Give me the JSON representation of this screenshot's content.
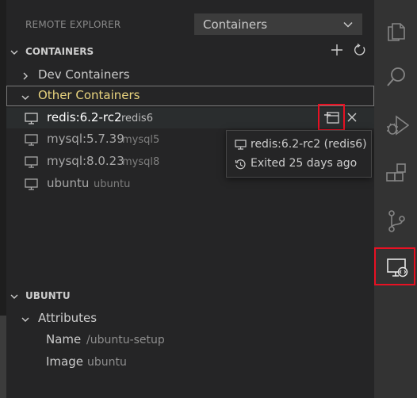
{
  "header": {
    "title": "REMOTE EXPLORER",
    "select_value": "Containers"
  },
  "containers_section": {
    "title": "CONTAINERS",
    "groups": [
      {
        "label": "Dev Containers",
        "expanded": false
      },
      {
        "label": "Other Containers",
        "expanded": true
      }
    ],
    "items": [
      {
        "name": "redis:6.2-rc2",
        "alias": "redis6"
      },
      {
        "name": "mysql:5.7.39",
        "alias": "mysql5"
      },
      {
        "name": "mysql:8.0.23",
        "alias": "mysql8"
      },
      {
        "name": "ubuntu",
        "alias": "ubuntu"
      }
    ]
  },
  "tooltip": {
    "line1": "redis:6.2-rc2 (redis6)",
    "line2": "Exited 25 days ago"
  },
  "details_section": {
    "title": "UBUNTU",
    "group": "Attributes",
    "attributes": [
      {
        "key": "Name",
        "value": "/ubuntu-setup"
      },
      {
        "key": "Image",
        "value": "ubuntu"
      }
    ]
  },
  "colors": {
    "highlight_box": "#e81123",
    "group_label": "#e8d37e",
    "sidebar_bg": "#252526",
    "activity_bg": "#333333"
  },
  "activity_bar": [
    "explorer-icon",
    "search-icon",
    "run-debug-icon",
    "extensions-icon",
    "source-control-icon",
    "remote-explorer-icon"
  ]
}
